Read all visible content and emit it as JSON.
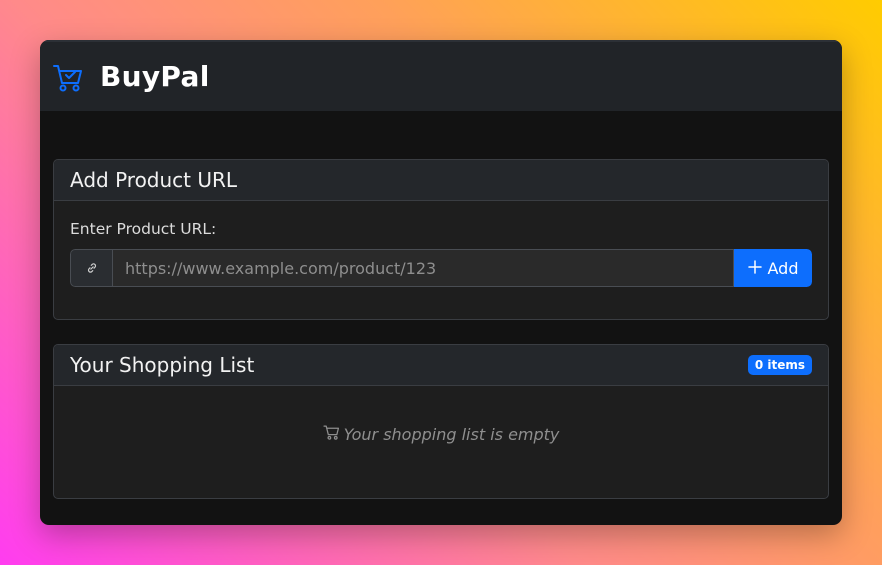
{
  "app": {
    "name": "BuyPal",
    "brand_icon": "cart-check-icon"
  },
  "add_card": {
    "title": "Add Product URL",
    "field_label": "Enter Product URL:",
    "link_icon": "link-icon",
    "input_placeholder": "https://www.example.com/product/123",
    "input_value": "",
    "add_button_label": "Add",
    "add_icon": "plus-icon"
  },
  "list_card": {
    "title": "Your Shopping List",
    "badge": "0 items",
    "empty_icon": "cart-icon",
    "empty_text": "Your shopping list is empty"
  },
  "colors": {
    "accent": "#0d6efd",
    "navbar_bg": "#212428",
    "window_bg": "#121212",
    "card_bg": "#1e1e1e"
  }
}
